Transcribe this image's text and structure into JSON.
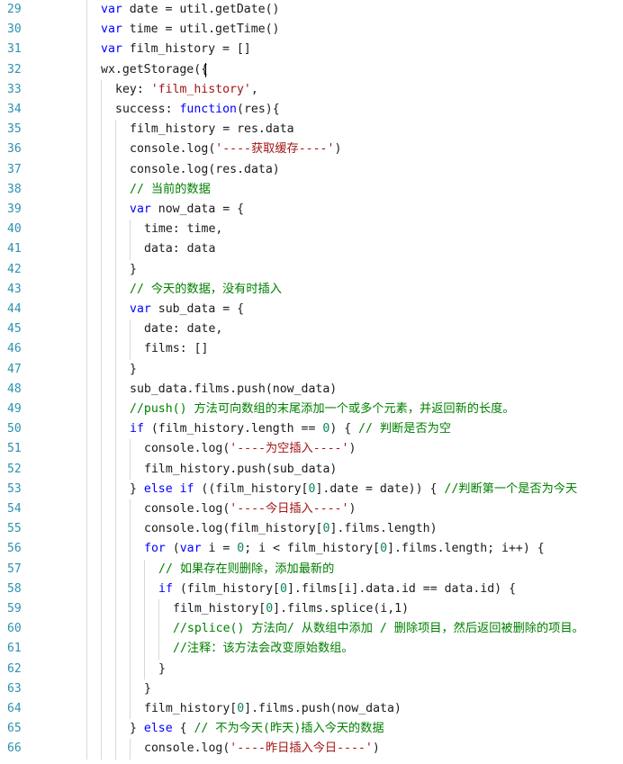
{
  "editor": {
    "lines": [
      {
        "num": "29",
        "indent": 1,
        "tokens": [
          {
            "t": "k",
            "v": "var"
          },
          {
            "t": "p",
            "v": " date = util.getDate()"
          }
        ]
      },
      {
        "num": "30",
        "indent": 1,
        "tokens": [
          {
            "t": "k",
            "v": "var"
          },
          {
            "t": "p",
            "v": " time = util.getTime()"
          }
        ]
      },
      {
        "num": "31",
        "indent": 1,
        "tokens": [
          {
            "t": "k",
            "v": "var"
          },
          {
            "t": "p",
            "v": " film_history = []"
          }
        ]
      },
      {
        "num": "32",
        "indent": 1,
        "tokens": [
          {
            "t": "p",
            "v": "wx.getStorage({"
          }
        ],
        "cursor": true
      },
      {
        "num": "33",
        "indent": 2,
        "tokens": [
          {
            "t": "p",
            "v": "key: "
          },
          {
            "t": "s",
            "v": "'film_history'"
          },
          {
            "t": "p",
            "v": ","
          }
        ]
      },
      {
        "num": "34",
        "indent": 2,
        "tokens": [
          {
            "t": "p",
            "v": "success: "
          },
          {
            "t": "k",
            "v": "function"
          },
          {
            "t": "p",
            "v": "(res){"
          }
        ]
      },
      {
        "num": "35",
        "indent": 3,
        "tokens": [
          {
            "t": "p",
            "v": "film_history = res.data"
          }
        ]
      },
      {
        "num": "36",
        "indent": 3,
        "tokens": [
          {
            "t": "p",
            "v": "console.log("
          },
          {
            "t": "s",
            "v": "'----获取缓存----'"
          },
          {
            "t": "p",
            "v": ")"
          }
        ]
      },
      {
        "num": "37",
        "indent": 3,
        "tokens": [
          {
            "t": "p",
            "v": "console.log(res.data)"
          }
        ]
      },
      {
        "num": "38",
        "indent": 3,
        "tokens": [
          {
            "t": "c",
            "v": "// 当前的数据"
          }
        ]
      },
      {
        "num": "39",
        "indent": 3,
        "tokens": [
          {
            "t": "k",
            "v": "var"
          },
          {
            "t": "p",
            "v": " now_data = {"
          }
        ]
      },
      {
        "num": "40",
        "indent": 4,
        "tokens": [
          {
            "t": "p",
            "v": "time: time,"
          }
        ]
      },
      {
        "num": "41",
        "indent": 4,
        "tokens": [
          {
            "t": "p",
            "v": "data: data"
          }
        ]
      },
      {
        "num": "42",
        "indent": 3,
        "tokens": [
          {
            "t": "p",
            "v": "}"
          }
        ]
      },
      {
        "num": "43",
        "indent": 3,
        "tokens": [
          {
            "t": "c",
            "v": "// 今天的数据，没有时插入"
          }
        ]
      },
      {
        "num": "44",
        "indent": 3,
        "tokens": [
          {
            "t": "k",
            "v": "var"
          },
          {
            "t": "p",
            "v": " sub_data = {"
          }
        ]
      },
      {
        "num": "45",
        "indent": 4,
        "tokens": [
          {
            "t": "p",
            "v": "date: date,"
          }
        ]
      },
      {
        "num": "46",
        "indent": 4,
        "tokens": [
          {
            "t": "p",
            "v": "films: []"
          }
        ]
      },
      {
        "num": "47",
        "indent": 3,
        "tokens": [
          {
            "t": "p",
            "v": "}"
          }
        ]
      },
      {
        "num": "48",
        "indent": 3,
        "tokens": [
          {
            "t": "p",
            "v": "sub_data.films.push(now_data)"
          }
        ]
      },
      {
        "num": "49",
        "indent": 3,
        "tokens": [
          {
            "t": "c",
            "v": "//push() 方法可向数组的末尾添加一个或多个元素，并返回新的长度。"
          }
        ]
      },
      {
        "num": "50",
        "indent": 3,
        "tokens": [
          {
            "t": "k",
            "v": "if"
          },
          {
            "t": "p",
            "v": " (film_history.length == "
          },
          {
            "t": "n",
            "v": "0"
          },
          {
            "t": "p",
            "v": ") { "
          },
          {
            "t": "c",
            "v": "// 判断是否为空"
          }
        ]
      },
      {
        "num": "51",
        "indent": 4,
        "tokens": [
          {
            "t": "p",
            "v": "console.log("
          },
          {
            "t": "s",
            "v": "'----为空插入----'"
          },
          {
            "t": "p",
            "v": ")"
          }
        ]
      },
      {
        "num": "52",
        "indent": 4,
        "tokens": [
          {
            "t": "p",
            "v": "film_history.push(sub_data)"
          }
        ]
      },
      {
        "num": "53",
        "indent": 3,
        "tokens": [
          {
            "t": "p",
            "v": "} "
          },
          {
            "t": "k",
            "v": "else if"
          },
          {
            "t": "p",
            "v": " ((film_history["
          },
          {
            "t": "n",
            "v": "0"
          },
          {
            "t": "p",
            "v": "].date = date)) { "
          },
          {
            "t": "c",
            "v": "//判断第一个是否为今天"
          }
        ]
      },
      {
        "num": "54",
        "indent": 4,
        "tokens": [
          {
            "t": "p",
            "v": "console.log("
          },
          {
            "t": "s",
            "v": "'----今日插入----'"
          },
          {
            "t": "p",
            "v": ")"
          }
        ]
      },
      {
        "num": "55",
        "indent": 4,
        "tokens": [
          {
            "t": "p",
            "v": "console.log(film_history["
          },
          {
            "t": "n",
            "v": "0"
          },
          {
            "t": "p",
            "v": "].films.length)"
          }
        ]
      },
      {
        "num": "56",
        "indent": 4,
        "tokens": [
          {
            "t": "k",
            "v": "for"
          },
          {
            "t": "p",
            "v": " ("
          },
          {
            "t": "k",
            "v": "var"
          },
          {
            "t": "p",
            "v": " i = "
          },
          {
            "t": "n",
            "v": "0"
          },
          {
            "t": "p",
            "v": "; i < film_history["
          },
          {
            "t": "n",
            "v": "0"
          },
          {
            "t": "p",
            "v": "].films.length; i++) {"
          }
        ]
      },
      {
        "num": "57",
        "indent": 5,
        "tokens": [
          {
            "t": "c",
            "v": "// 如果存在则删除，添加最新的"
          }
        ]
      },
      {
        "num": "58",
        "indent": 5,
        "tokens": [
          {
            "t": "k",
            "v": "if"
          },
          {
            "t": "p",
            "v": " (film_history["
          },
          {
            "t": "n",
            "v": "0"
          },
          {
            "t": "p",
            "v": "].films[i].data.id == data.id) {"
          }
        ]
      },
      {
        "num": "59",
        "indent": 6,
        "tokens": [
          {
            "t": "p",
            "v": "film_history["
          },
          {
            "t": "n",
            "v": "0"
          },
          {
            "t": "p",
            "v": "].films.splice(i,1)"
          }
        ]
      },
      {
        "num": "60",
        "indent": 6,
        "tokens": [
          {
            "t": "c",
            "v": "//splice() 方法向/ 从数组中添加 / 删除项目，然后返回被删除的项目。"
          }
        ]
      },
      {
        "num": "61",
        "indent": 6,
        "tokens": [
          {
            "t": "c",
            "v": "//注释：该方法会改变原始数组。"
          }
        ]
      },
      {
        "num": "62",
        "indent": 5,
        "tokens": [
          {
            "t": "p",
            "v": "}"
          }
        ]
      },
      {
        "num": "63",
        "indent": 4,
        "tokens": [
          {
            "t": "p",
            "v": "}"
          }
        ]
      },
      {
        "num": "64",
        "indent": 4,
        "tokens": [
          {
            "t": "p",
            "v": "film_history["
          },
          {
            "t": "n",
            "v": "0"
          },
          {
            "t": "p",
            "v": "].films.push(now_data)"
          }
        ]
      },
      {
        "num": "65",
        "indent": 3,
        "tokens": [
          {
            "t": "p",
            "v": "} "
          },
          {
            "t": "k",
            "v": "else"
          },
          {
            "t": "p",
            "v": " { "
          },
          {
            "t": "c",
            "v": "// 不为今天(昨天)插入今天的数据"
          }
        ]
      },
      {
        "num": "66",
        "indent": 4,
        "tokens": [
          {
            "t": "p",
            "v": "console.log("
          },
          {
            "t": "s",
            "v": "'----昨日插入今日----'"
          },
          {
            "t": "p",
            "v": ")"
          }
        ]
      }
    ]
  },
  "colors": {
    "keyword": "#0000ff",
    "string": "#a31515",
    "comment": "#008000",
    "number": "#098658",
    "line_number": "#2b91af"
  }
}
